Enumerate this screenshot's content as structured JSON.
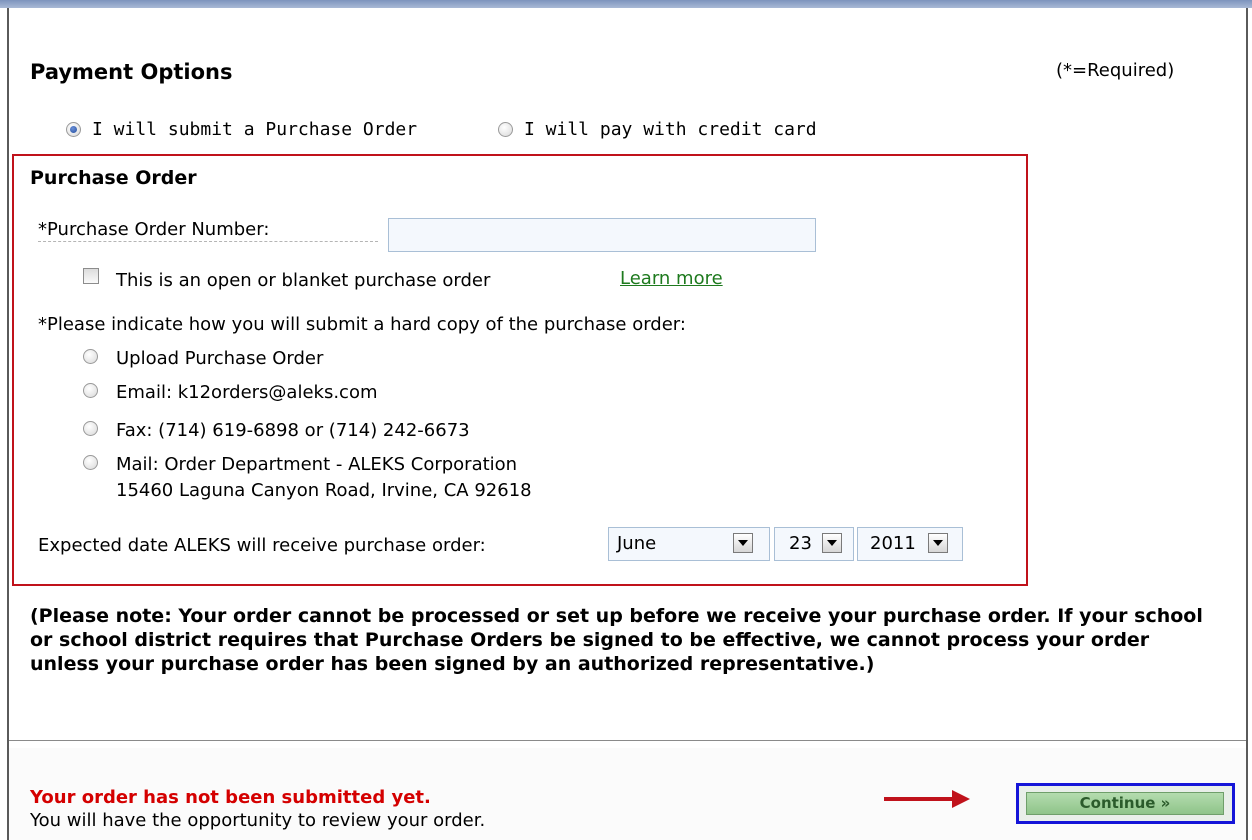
{
  "header": {
    "title": "Payment Options",
    "required_note": "(*=Required)"
  },
  "payment_method": {
    "options": [
      {
        "label": "I will submit a Purchase Order",
        "selected": true
      },
      {
        "label": "I will pay with credit card",
        "selected": false
      }
    ]
  },
  "purchase_order": {
    "title": "Purchase Order",
    "number_label": "*Purchase Order Number:",
    "number_value": "",
    "blanket_checkbox_label": "This is an open or blanket purchase order",
    "blanket_checked": false,
    "learn_more": "Learn more",
    "hard_copy_prompt": "*Please indicate how you will submit a hard copy of the purchase order:",
    "hard_copy_options": [
      "Upload Purchase Order",
      "Email: k12orders@aleks.com",
      "Fax: (714) 619-6898 or (714) 242-6673",
      "Mail: Order Department - ALEKS Corporation"
    ],
    "mail_address_line2": "15460 Laguna Canyon Road, Irvine, CA 92618",
    "expected_date_label": "Expected date ALEKS will receive purchase order:",
    "expected_month": "June",
    "expected_day": "23",
    "expected_year": "2011"
  },
  "note": "(Please note: Your order cannot be processed or set up before we receive your purchase order. If your school or school district requires that Purchase Orders be signed to be effective, we cannot process your order unless your purchase order has been signed by an authorized representative.)",
  "footer": {
    "warning": "Your order has not been submitted yet.",
    "subtext": "You will have the opportunity to review your order.",
    "continue_label": "Continue »"
  },
  "colors": {
    "highlight_box": "#c0121b",
    "button_outline": "#1515d8",
    "warning_text": "#d40000",
    "link": "#1e7a1e"
  },
  "icons": [
    "arrow-right-icon",
    "dropdown-arrow-icon"
  ]
}
